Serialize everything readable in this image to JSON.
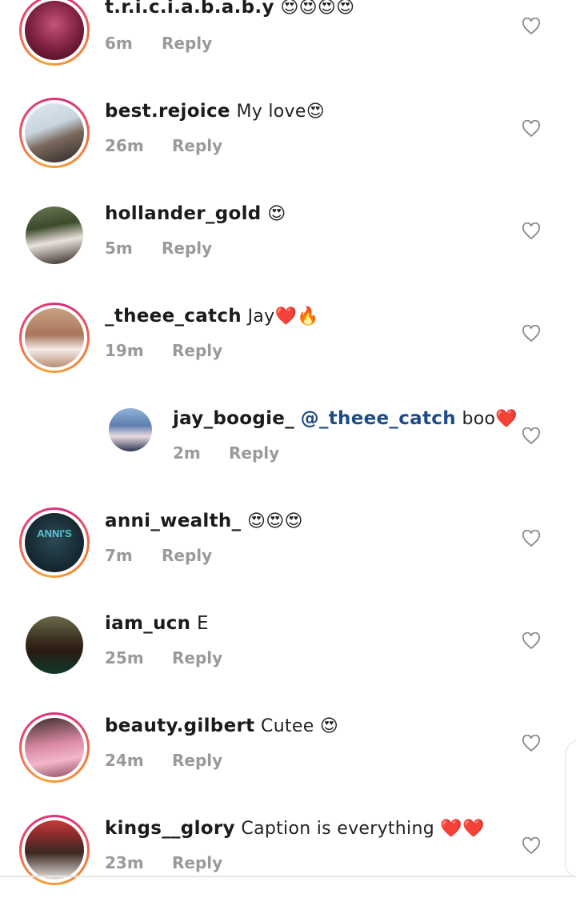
{
  "comments": [
    {
      "username": "t.r.i.c.i.a.b.a.b.y",
      "text": "😍😍😍😍",
      "time": "6m",
      "reply": "Reply"
    },
    {
      "username": "best.rejoice",
      "text": "My love😍",
      "time": "26m",
      "reply": "Reply"
    },
    {
      "username": "hollander_gold",
      "text": "😍",
      "time": "5m",
      "reply": "Reply"
    },
    {
      "username": "_theee_catch",
      "text": "Jay❤️🔥",
      "time": "19m",
      "reply": "Reply"
    },
    {
      "username": "jay_boogie_",
      "mention": "@_theee_catch",
      "text": "boo❤️",
      "time": "2m",
      "reply": "Reply"
    },
    {
      "username": "anni_wealth_",
      "text": "😍😍😍",
      "time": "7m",
      "reply": "Reply"
    },
    {
      "username": "iam_ucn",
      "text": "E",
      "time": "25m",
      "reply": "Reply"
    },
    {
      "username": "beauty.gilbert",
      "text": "Cutee 😍",
      "time": "24m",
      "reply": "Reply"
    },
    {
      "username": "kings__glory",
      "text": "Caption is everything ❤️❤️",
      "time": "23m",
      "reply": "Reply"
    }
  ],
  "avatar_badge_text": "ANNI'S",
  "colors": {
    "story_ring": "#e8486a",
    "mention": "#1d4b86",
    "meta": "#9a9a9a"
  },
  "icons": {
    "like": "heart-outline-icon"
  }
}
